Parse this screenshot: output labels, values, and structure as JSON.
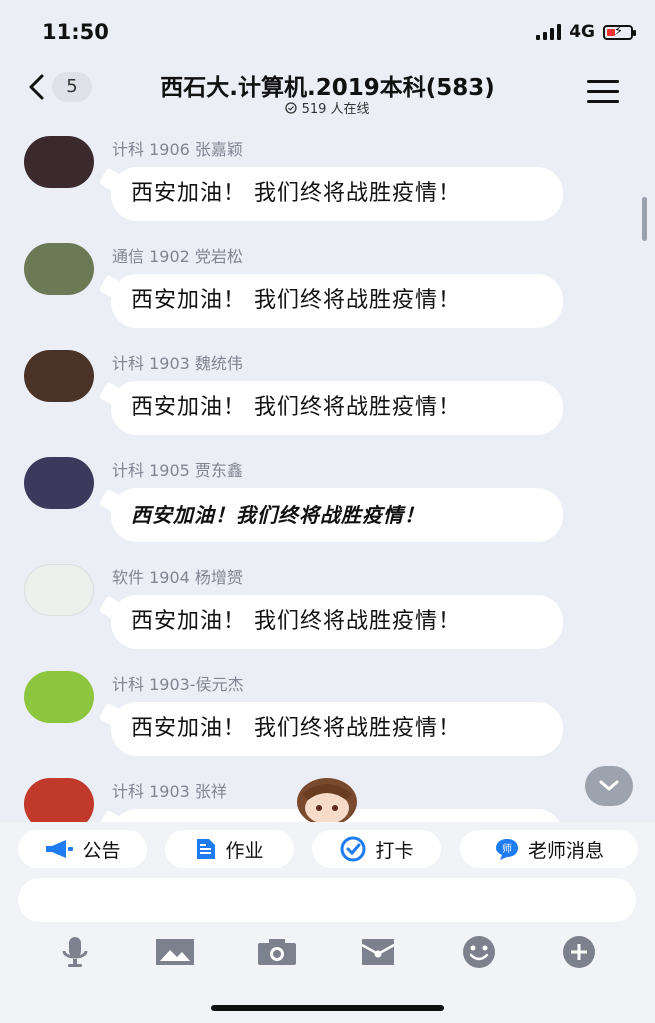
{
  "status_bar": {
    "time": "11:50",
    "network": "4G"
  },
  "header": {
    "back_count": "5",
    "title": "西石大.计算机.2019本科(583)",
    "online": "519 人在线"
  },
  "messages": [
    {
      "sender": "计科 1906 张嘉颖",
      "text": "西安加油！ 我们终将战胜疫情！",
      "avatar_color": "#3a2a2e"
    },
    {
      "sender": "通信 1902 党岩松",
      "text": "西安加油！ 我们终将战胜疫情！",
      "avatar_color": "#6b7a55"
    },
    {
      "sender": "计科 1903 魏统伟",
      "text": "西安加油！ 我们终将战胜疫情！",
      "avatar_color": "#4a3226"
    },
    {
      "sender": "计科 1905 贾东鑫",
      "text": "西安加油！我们终将战胜疫情！",
      "avatar_color": "#3b3a5c"
    },
    {
      "sender": "软件 1904 杨增赟",
      "text": "西安加油！ 我们终将战胜疫情！",
      "avatar_color": "#eef0ee"
    },
    {
      "sender": "计科 1903-侯元杰",
      "text": "西安加油！ 我们终将战胜疫情！",
      "avatar_color": "#8cc63f"
    },
    {
      "sender": "计科 1903 张祥",
      "text": "",
      "avatar_color": "#c0392b"
    }
  ],
  "quick_actions": [
    {
      "label": "公告",
      "icon": "megaphone-icon"
    },
    {
      "label": "作业",
      "icon": "document-icon"
    },
    {
      "label": "打卡",
      "icon": "checkin-icon"
    },
    {
      "label": "老师消息",
      "icon": "teacher-message-icon"
    }
  ],
  "input": {
    "placeholder": ""
  },
  "toolbar": [
    "microphone-icon",
    "image-icon",
    "camera-icon",
    "red-packet-icon",
    "emoji-icon",
    "plus-icon"
  ],
  "colors": {
    "accent": "#1e7bf0",
    "background": "#eceef5",
    "bubble": "#ffffff",
    "name": "#808592"
  }
}
